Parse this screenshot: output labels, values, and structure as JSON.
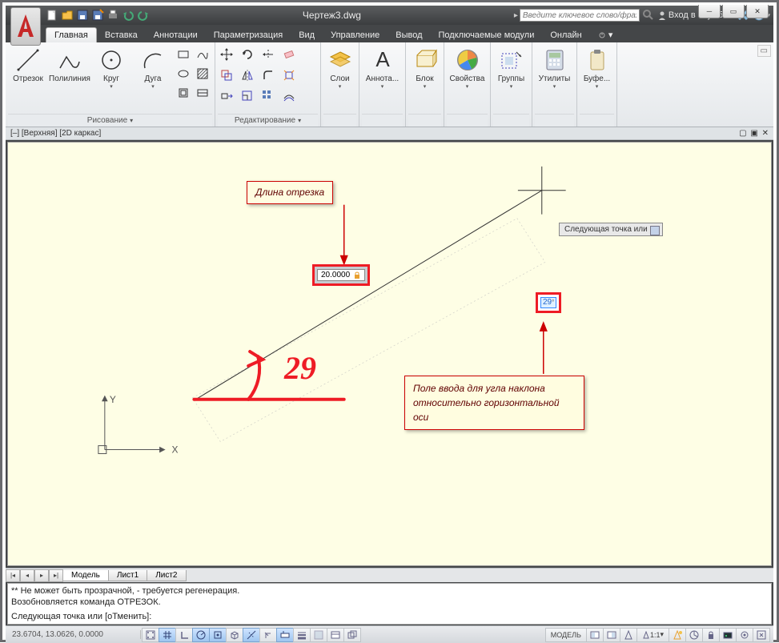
{
  "window": {
    "title": "Чертеж3.dwg",
    "search_placeholder": "Введите ключевое слово/фразу",
    "signin": "Вход в службы"
  },
  "tabs": [
    "Главная",
    "Вставка",
    "Аннотации",
    "Параметризация",
    "Вид",
    "Управление",
    "Вывод",
    "Подключаемые модули",
    "Онлайн"
  ],
  "ribbon": {
    "draw": {
      "title": "Рисование",
      "tools": {
        "line": "Отрезок",
        "polyline": "Полилиния",
        "circle": "Круг",
        "arc": "Дуга"
      }
    },
    "edit": {
      "title": "Редактирование"
    },
    "layers": {
      "title": "Слои"
    },
    "annot": {
      "title": "Аннота..."
    },
    "block": {
      "title": "Блок"
    },
    "props": {
      "title": "Свойства"
    },
    "groups": {
      "title": "Группы"
    },
    "utils": {
      "title": "Утилиты"
    },
    "clip": {
      "title": "Буфе..."
    }
  },
  "viewport_label": "[–] [Верхняя] [2D каркас]",
  "canvas": {
    "length_callout": "Длина отрезка",
    "length_value": "20.0000",
    "angle_callout": "Поле ввода для угла наклона относительно горизонтальной оси",
    "angle_value": "29",
    "tooltip": "Следующая точка или",
    "handwritten": "29",
    "axis_x": "X",
    "axis_y": "Y"
  },
  "sheets": {
    "model": "Модель",
    "sheet1": "Лист1",
    "sheet2": "Лист2"
  },
  "cmd": {
    "l1": "** Не может быть прозрачной, - требуется регенерация.",
    "l2": "Возобновляется команда ОТРЕЗОК.",
    "prompt": "Следующая точка или [оТменить]:"
  },
  "status": {
    "coords": "23.6704, 13.0626, 0.0000",
    "model": "МОДЕЛЬ",
    "scale": "1:1"
  }
}
